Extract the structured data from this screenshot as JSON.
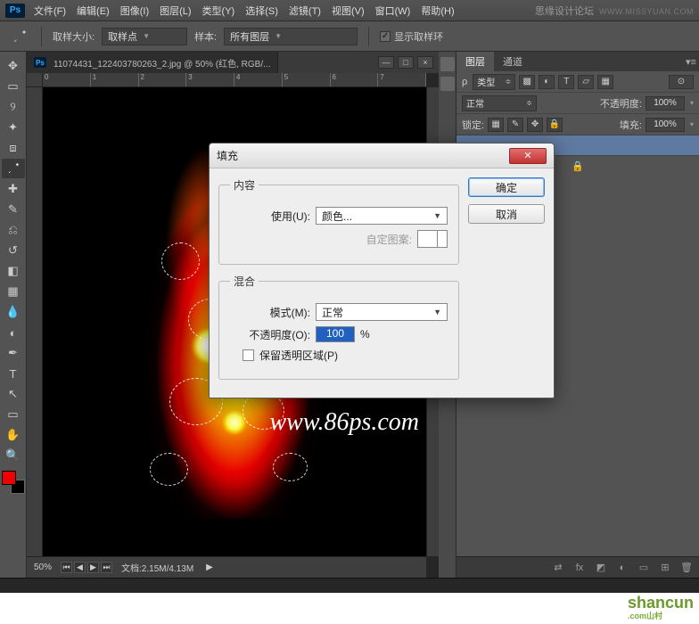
{
  "brand": {
    "name": "思缘设计论坛",
    "url": "WWW.MISSYUAN.COM"
  },
  "menu": {
    "file": "文件(F)",
    "edit": "编辑(E)",
    "image": "图像(I)",
    "layer": "图层(L)",
    "type": "类型(Y)",
    "select": "选择(S)",
    "filter": "滤镜(T)",
    "view": "视图(V)",
    "window": "窗口(W)",
    "help": "帮助(H)"
  },
  "options": {
    "sample_size_label": "取样大小:",
    "sample_size_value": "取样点",
    "sample_label": "样本:",
    "sample_value": "所有图层",
    "show_ring": "显示取样环"
  },
  "document": {
    "tab_title": "11074431_122403780263_2.jpg @ 50% (红色, RGB/...",
    "zoom": "50%",
    "doc_info": "文档:2.15M/4.13M",
    "ruler_ticks": [
      "0",
      "1",
      "2",
      "3",
      "4",
      "5",
      "6",
      "7"
    ]
  },
  "watermark": "www.86ps.com",
  "panel": {
    "tab_layers": "图层",
    "tab_channels": "通道",
    "filter_label": "类型",
    "blend_mode": "正常",
    "opacity_label": "不透明度:",
    "opacity_value": "100%",
    "lock_label": "锁定:",
    "fill_label": "填充:",
    "fill_value": "100%"
  },
  "dialog": {
    "title": "填充",
    "ok": "确定",
    "cancel": "取消",
    "group_content": "内容",
    "use_label": "使用(U):",
    "use_value": "颜色...",
    "pattern_label": "自定图案:",
    "group_blend": "混合",
    "mode_label": "模式(M):",
    "mode_value": "正常",
    "opacity_label": "不透明度(O):",
    "opacity_value": "100",
    "opacity_unit": "%",
    "preserve_label": "保留透明区域(P)"
  },
  "corner_logo": {
    "main": "shancun",
    "sub": ".com山村"
  }
}
